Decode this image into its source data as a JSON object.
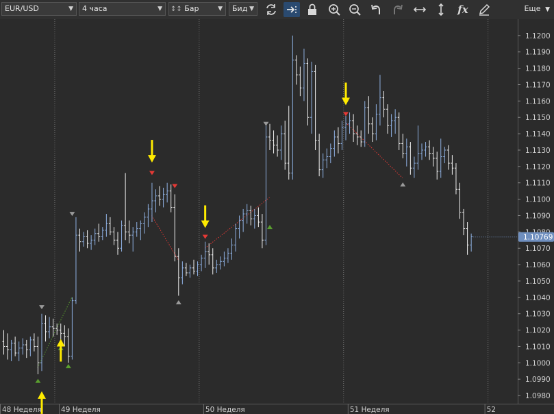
{
  "toolbar": {
    "symbol": "EUR/USD",
    "timeframe": "4 часа",
    "chart_type": "Бар",
    "price_type": "Бид",
    "more_label": "Еще",
    "fx_label": "fx"
  },
  "chart_data": {
    "type": "ohlc-bar",
    "symbol": "EUR/USD",
    "timeframe": "4 часа",
    "y_range": [
      1.0975,
      1.121
    ],
    "y_ticks": [
      "1.1200",
      "1.1190",
      "1.1180",
      "1.1170",
      "1.1160",
      "1.1150",
      "1.1140",
      "1.1130",
      "1.1120",
      "1.1110",
      "1.1100",
      "1.1090",
      "1.1080",
      "1.1070",
      "1.1060",
      "1.1050",
      "1.1040",
      "1.1030",
      "1.1020",
      "1.1010",
      "1.1000",
      "1.0990",
      "1.0980"
    ],
    "x_labels": [
      {
        "label": "48 Неделя",
        "index": 0
      },
      {
        "label": "49 Неделя",
        "index": 15
      },
      {
        "label": "50 Неделя",
        "index": 53
      },
      {
        "label": "51 Неделя",
        "index": 91
      },
      {
        "label": "52",
        "index": 127
      }
    ],
    "week_separators": [
      13,
      51,
      89,
      127
    ],
    "current_price": "1.10769",
    "current_price_value": 1.10769,
    "bars": [
      [
        1.1013,
        1.102,
        1.1005,
        1.101
      ],
      [
        1.101,
        1.1018,
        1.1002,
        1.1008
      ],
      [
        1.1008,
        1.1014,
        1.1001,
        1.1012
      ],
      [
        1.1012,
        1.1016,
        1.1004,
        1.1006
      ],
      [
        1.1006,
        1.1013,
        1.1001,
        1.1009
      ],
      [
        1.1009,
        1.1015,
        1.1005,
        1.1011
      ],
      [
        1.1011,
        1.1014,
        1.1003,
        1.1008
      ],
      [
        1.1008,
        1.1016,
        1.1004,
        1.1014
      ],
      [
        1.1014,
        1.1018,
        1.1007,
        1.101
      ],
      [
        1.101,
        1.1016,
        1.0993,
        1.1
      ],
      [
        1.1,
        1.103,
        1.0995,
        1.1024
      ],
      [
        1.1024,
        1.1029,
        1.1013,
        1.1019
      ],
      [
        1.1019,
        1.1028,
        1.1015,
        1.1022
      ],
      [
        1.1022,
        1.1027,
        1.1016,
        1.1021
      ],
      [
        1.1021,
        1.1024,
        1.1017,
        1.102
      ],
      [
        1.102,
        1.1024,
        1.1014,
        1.1018
      ],
      [
        1.1018,
        1.1023,
        1.101,
        1.1016
      ],
      [
        1.1016,
        1.1021,
        1.1,
        1.1004
      ],
      [
        1.1004,
        1.104,
        1.1002,
        1.1038
      ],
      [
        1.1038,
        1.1089,
        1.1036,
        1.1078
      ],
      [
        1.1078,
        1.1082,
        1.1068,
        1.1074
      ],
      [
        1.1074,
        1.108,
        1.1071,
        1.1077
      ],
      [
        1.1077,
        1.1081,
        1.107,
        1.1073
      ],
      [
        1.1073,
        1.1078,
        1.1069,
        1.1075
      ],
      [
        1.1075,
        1.1082,
        1.1072,
        1.1079
      ],
      [
        1.1079,
        1.1085,
        1.1074,
        1.1077
      ],
      [
        1.1077,
        1.1083,
        1.1075,
        1.1081
      ],
      [
        1.1081,
        1.1091,
        1.1077,
        1.1085
      ],
      [
        1.1085,
        1.1089,
        1.1078,
        1.108
      ],
      [
        1.108,
        1.1083,
        1.1072,
        1.1075
      ],
      [
        1.1075,
        1.108,
        1.1066,
        1.107
      ],
      [
        1.107,
        1.1087,
        1.1068,
        1.1084
      ],
      [
        1.1084,
        1.1116,
        1.1075,
        1.108
      ],
      [
        1.108,
        1.1087,
        1.1073,
        1.1078
      ],
      [
        1.1078,
        1.1083,
        1.1068,
        1.108
      ],
      [
        1.108,
        1.1086,
        1.1077,
        1.1082
      ],
      [
        1.1082,
        1.1087,
        1.1075,
        1.1085
      ],
      [
        1.1085,
        1.1092,
        1.1079,
        1.1089
      ],
      [
        1.1089,
        1.1097,
        1.1083,
        1.1094
      ],
      [
        1.1094,
        1.111,
        1.1086,
        1.1099
      ],
      [
        1.1099,
        1.1106,
        1.1092,
        1.1102
      ],
      [
        1.1102,
        1.1108,
        1.1096,
        1.11
      ],
      [
        1.11,
        1.1107,
        1.1095,
        1.1103
      ],
      [
        1.1103,
        1.111,
        1.1098,
        1.1105
      ],
      [
        1.1105,
        1.1109,
        1.1092,
        1.1095
      ],
      [
        1.1095,
        1.1103,
        1.1062,
        1.1065
      ],
      [
        1.1065,
        1.107,
        1.1041,
        1.1052
      ],
      [
        1.1052,
        1.1062,
        1.1048,
        1.1058
      ],
      [
        1.1058,
        1.1061,
        1.1053,
        1.1055
      ],
      [
        1.1055,
        1.106,
        1.1052,
        1.1058
      ],
      [
        1.1058,
        1.1063,
        1.1054,
        1.1056
      ],
      [
        1.1056,
        1.1062,
        1.1053,
        1.106
      ],
      [
        1.106,
        1.1066,
        1.1056,
        1.1064
      ],
      [
        1.1064,
        1.1074,
        1.1058,
        1.1068
      ],
      [
        1.1068,
        1.1073,
        1.106,
        1.1066
      ],
      [
        1.1066,
        1.107,
        1.1054,
        1.1058
      ],
      [
        1.1058,
        1.1063,
        1.1055,
        1.106
      ],
      [
        1.106,
        1.1065,
        1.1057,
        1.1062
      ],
      [
        1.1062,
        1.1068,
        1.1059,
        1.1064
      ],
      [
        1.1064,
        1.107,
        1.1061,
        1.1067
      ],
      [
        1.1067,
        1.1076,
        1.1063,
        1.1072
      ],
      [
        1.1072,
        1.1085,
        1.1068,
        1.1082
      ],
      [
        1.1082,
        1.109,
        1.1076,
        1.1087
      ],
      [
        1.1087,
        1.1094,
        1.108,
        1.1091
      ],
      [
        1.1091,
        1.1097,
        1.1085,
        1.1093
      ],
      [
        1.1093,
        1.1096,
        1.1084,
        1.1088
      ],
      [
        1.1088,
        1.1094,
        1.1082,
        1.109
      ],
      [
        1.109,
        1.1095,
        1.1083,
        1.1086
      ],
      [
        1.1086,
        1.1091,
        1.107,
        1.1075
      ],
      [
        1.1075,
        1.1145,
        1.1072,
        1.1138
      ],
      [
        1.1138,
        1.1146,
        1.113,
        1.1136
      ],
      [
        1.1136,
        1.1142,
        1.1128,
        1.1133
      ],
      [
        1.1133,
        1.1139,
        1.1126,
        1.113
      ],
      [
        1.113,
        1.1145,
        1.1124,
        1.114
      ],
      [
        1.114,
        1.1148,
        1.1118,
        1.1122
      ],
      [
        1.1122,
        1.1157,
        1.1112,
        1.1116
      ],
      [
        1.1116,
        1.12,
        1.1112,
        1.1185
      ],
      [
        1.1185,
        1.1188,
        1.117,
        1.1176
      ],
      [
        1.1176,
        1.1181,
        1.1163,
        1.1168
      ],
      [
        1.1168,
        1.1192,
        1.116,
        1.1183
      ],
      [
        1.1183,
        1.1186,
        1.1145,
        1.115
      ],
      [
        1.115,
        1.1184,
        1.114,
        1.1178
      ],
      [
        1.1178,
        1.1182,
        1.113,
        1.1136
      ],
      [
        1.1136,
        1.114,
        1.1114,
        1.1118
      ],
      [
        1.1118,
        1.1128,
        1.1113,
        1.1124
      ],
      [
        1.1124,
        1.1131,
        1.1119,
        1.1126
      ],
      [
        1.1126,
        1.1134,
        1.1122,
        1.1131
      ],
      [
        1.1131,
        1.1142,
        1.1126,
        1.1138
      ],
      [
        1.1138,
        1.1144,
        1.1128,
        1.1134
      ],
      [
        1.1134,
        1.1148,
        1.113,
        1.1144
      ],
      [
        1.1144,
        1.1151,
        1.1136,
        1.1146
      ],
      [
        1.1146,
        1.1153,
        1.114,
        1.1148
      ],
      [
        1.1148,
        1.1152,
        1.1135,
        1.114
      ],
      [
        1.114,
        1.1145,
        1.1133,
        1.1138
      ],
      [
        1.1138,
        1.1142,
        1.1132,
        1.1135
      ],
      [
        1.1135,
        1.116,
        1.1132,
        1.1156
      ],
      [
        1.1156,
        1.1163,
        1.114,
        1.1146
      ],
      [
        1.1146,
        1.115,
        1.1135,
        1.114
      ],
      [
        1.114,
        1.1158,
        1.1136,
        1.1152
      ],
      [
        1.1152,
        1.1176,
        1.1145,
        1.1162
      ],
      [
        1.1162,
        1.1166,
        1.115,
        1.1155
      ],
      [
        1.1155,
        1.1158,
        1.114,
        1.1145
      ],
      [
        1.1145,
        1.1152,
        1.1138,
        1.1148
      ],
      [
        1.1148,
        1.1155,
        1.114,
        1.115
      ],
      [
        1.115,
        1.1153,
        1.113,
        1.1134
      ],
      [
        1.1134,
        1.114,
        1.1125,
        1.1128
      ],
      [
        1.1128,
        1.1137,
        1.112,
        1.1132
      ],
      [
        1.1132,
        1.1135,
        1.1115,
        1.1119
      ],
      [
        1.1119,
        1.1126,
        1.1113,
        1.1122
      ],
      [
        1.1122,
        1.1145,
        1.1118,
        1.1128
      ],
      [
        1.1128,
        1.1134,
        1.1124,
        1.113
      ],
      [
        1.113,
        1.1135,
        1.1126,
        1.1132
      ],
      [
        1.1132,
        1.1136,
        1.1124,
        1.1128
      ],
      [
        1.1128,
        1.1132,
        1.112,
        1.1125
      ],
      [
        1.1125,
        1.1129,
        1.1112,
        1.1117
      ],
      [
        1.1117,
        1.1137,
        1.1113,
        1.1126
      ],
      [
        1.1126,
        1.1132,
        1.1122,
        1.113
      ],
      [
        1.113,
        1.1133,
        1.1118,
        1.1122
      ],
      [
        1.1122,
        1.1127,
        1.1115,
        1.1119
      ],
      [
        1.1119,
        1.1122,
        1.1103,
        1.1106
      ],
      [
        1.1106,
        1.111,
        1.1088,
        1.1092
      ],
      [
        1.1092,
        1.1094,
        1.1078,
        1.1082
      ],
      [
        1.1082,
        1.1086,
        1.1066,
        1.1072
      ],
      [
        1.1072,
        1.1079,
        1.1068,
        1.1077
      ]
    ],
    "fractal_markers": [
      {
        "index": 9,
        "price": 1.0989,
        "type": "up",
        "color": "#5a9e2f"
      },
      {
        "index": 10,
        "price": 1.1034,
        "type": "down",
        "color": "#9a9a9a"
      },
      {
        "index": 15,
        "price": 1.1009,
        "type": "up",
        "color": "#5a9e2f"
      },
      {
        "index": 17,
        "price": 1.0998,
        "type": "up",
        "color": "#5a9e2f"
      },
      {
        "index": 18,
        "price": 1.1091,
        "type": "down",
        "color": "#9a9a9a"
      },
      {
        "index": 39,
        "price": 1.1116,
        "type": "down",
        "color": "#e53935"
      },
      {
        "index": 45,
        "price": 1.1108,
        "type": "down",
        "color": "#e53935"
      },
      {
        "index": 46,
        "price": 1.1037,
        "type": "up",
        "color": "#9a9a9a"
      },
      {
        "index": 53,
        "price": 1.1077,
        "type": "down",
        "color": "#e53935"
      },
      {
        "index": 69,
        "price": 1.1146,
        "type": "down",
        "color": "#9a9a9a"
      },
      {
        "index": 70,
        "price": 1.1083,
        "type": "up",
        "color": "#5a9e2f"
      },
      {
        "index": 90,
        "price": 1.1152,
        "type": "down",
        "color": "#e53935"
      },
      {
        "index": 105,
        "price": 1.1109,
        "type": "up",
        "color": "#9a9a9a"
      }
    ],
    "dotted_lines": [
      {
        "from": [
          9,
          1.0997
        ],
        "to": [
          18,
          1.104
        ],
        "color": "#5a9e2f"
      },
      {
        "from": [
          39,
          1.109
        ],
        "to": [
          46,
          1.1063
        ],
        "color": "#e53935"
      },
      {
        "from": [
          53,
          1.107
        ],
        "to": [
          70,
          1.1101
        ],
        "color": "#e53935"
      },
      {
        "from": [
          90,
          1.1147
        ],
        "to": [
          105,
          1.1113
        ],
        "color": "#e53935"
      }
    ],
    "annotation_arrows": [
      {
        "index": 10,
        "price": 1.0983,
        "direction": "up"
      },
      {
        "index": 15,
        "price": 1.1015,
        "direction": "up"
      },
      {
        "index": 39,
        "price": 1.1122,
        "direction": "down"
      },
      {
        "index": 53,
        "price": 1.1082,
        "direction": "down"
      },
      {
        "index": 90,
        "price": 1.1157,
        "direction": "down"
      }
    ]
  }
}
